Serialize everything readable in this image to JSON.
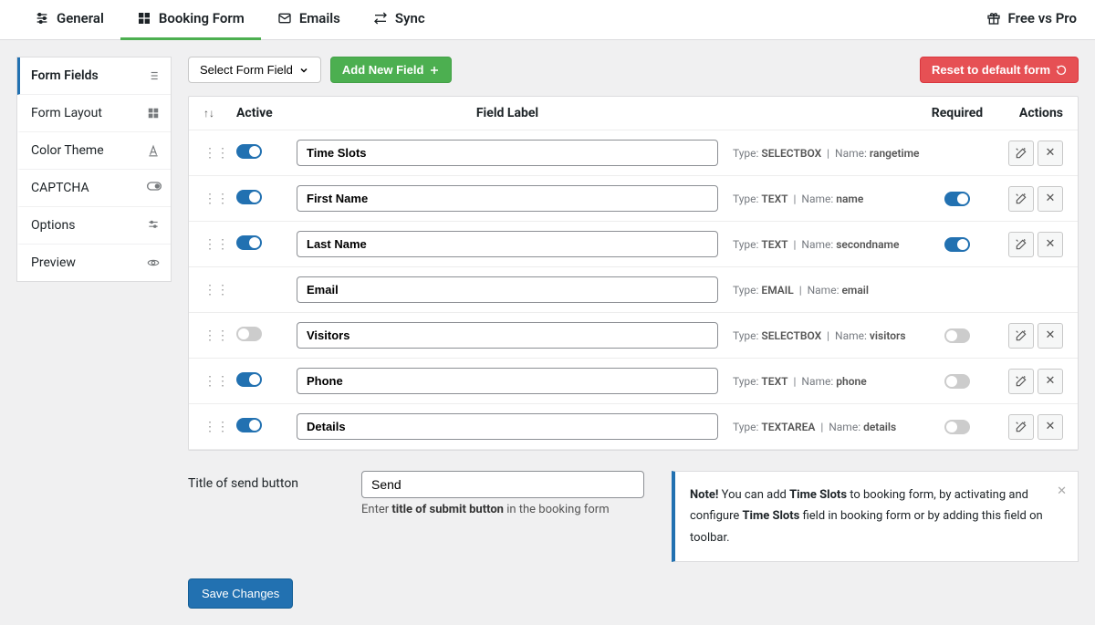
{
  "topTabs": [
    {
      "label": "General"
    },
    {
      "label": "Booking Form"
    },
    {
      "label": "Emails"
    },
    {
      "label": "Sync"
    }
  ],
  "activeTopTab": 1,
  "freeVsPro": "Free vs Pro",
  "sidebar": [
    {
      "label": "Form Fields"
    },
    {
      "label": "Form Layout"
    },
    {
      "label": "Color Theme"
    },
    {
      "label": "CAPTCHA"
    },
    {
      "label": "Options"
    },
    {
      "label": "Preview"
    }
  ],
  "activeSidebar": 0,
  "toolbar": {
    "selectFormField": "Select Form Field",
    "addNewField": "Add New Field",
    "resetDefault": "Reset to default form"
  },
  "columns": {
    "active": "Active",
    "fieldLabel": "Field Label",
    "required": "Required",
    "actions": "Actions"
  },
  "typePrefix": "Type:",
  "namePrefix": "Name:",
  "rows": [
    {
      "active": true,
      "label": "Time Slots",
      "type": "SELECTBOX",
      "name": "rangetime",
      "required": null,
      "actions": true
    },
    {
      "active": true,
      "label": "First Name",
      "type": "TEXT",
      "name": "name",
      "required": true,
      "actions": true
    },
    {
      "active": true,
      "label": "Last Name",
      "type": "TEXT",
      "name": "secondname",
      "required": true,
      "actions": true
    },
    {
      "active": null,
      "label": "Email",
      "type": "EMAIL",
      "name": "email",
      "required": null,
      "actions": false
    },
    {
      "active": false,
      "label": "Visitors",
      "type": "SELECTBOX",
      "name": "visitors",
      "required": false,
      "actions": true
    },
    {
      "active": true,
      "label": "Phone",
      "type": "TEXT",
      "name": "phone",
      "required": false,
      "actions": true
    },
    {
      "active": true,
      "label": "Details",
      "type": "TEXTAREA",
      "name": "details",
      "required": false,
      "actions": true
    }
  ],
  "sendSection": {
    "label": "Title of send button",
    "value": "Send",
    "desc_pre": "Enter ",
    "desc_b": "title of submit button",
    "desc_post": " in the booking form"
  },
  "note": {
    "bold1": "Note!",
    "t1": " You can add ",
    "bold2": "Time Slots",
    "t2": " to booking form, by activating and configure ",
    "bold3": "Time Slots",
    "t3": " field in booking form or by adding this field on toolbar."
  },
  "saveChanges": "Save Changes"
}
